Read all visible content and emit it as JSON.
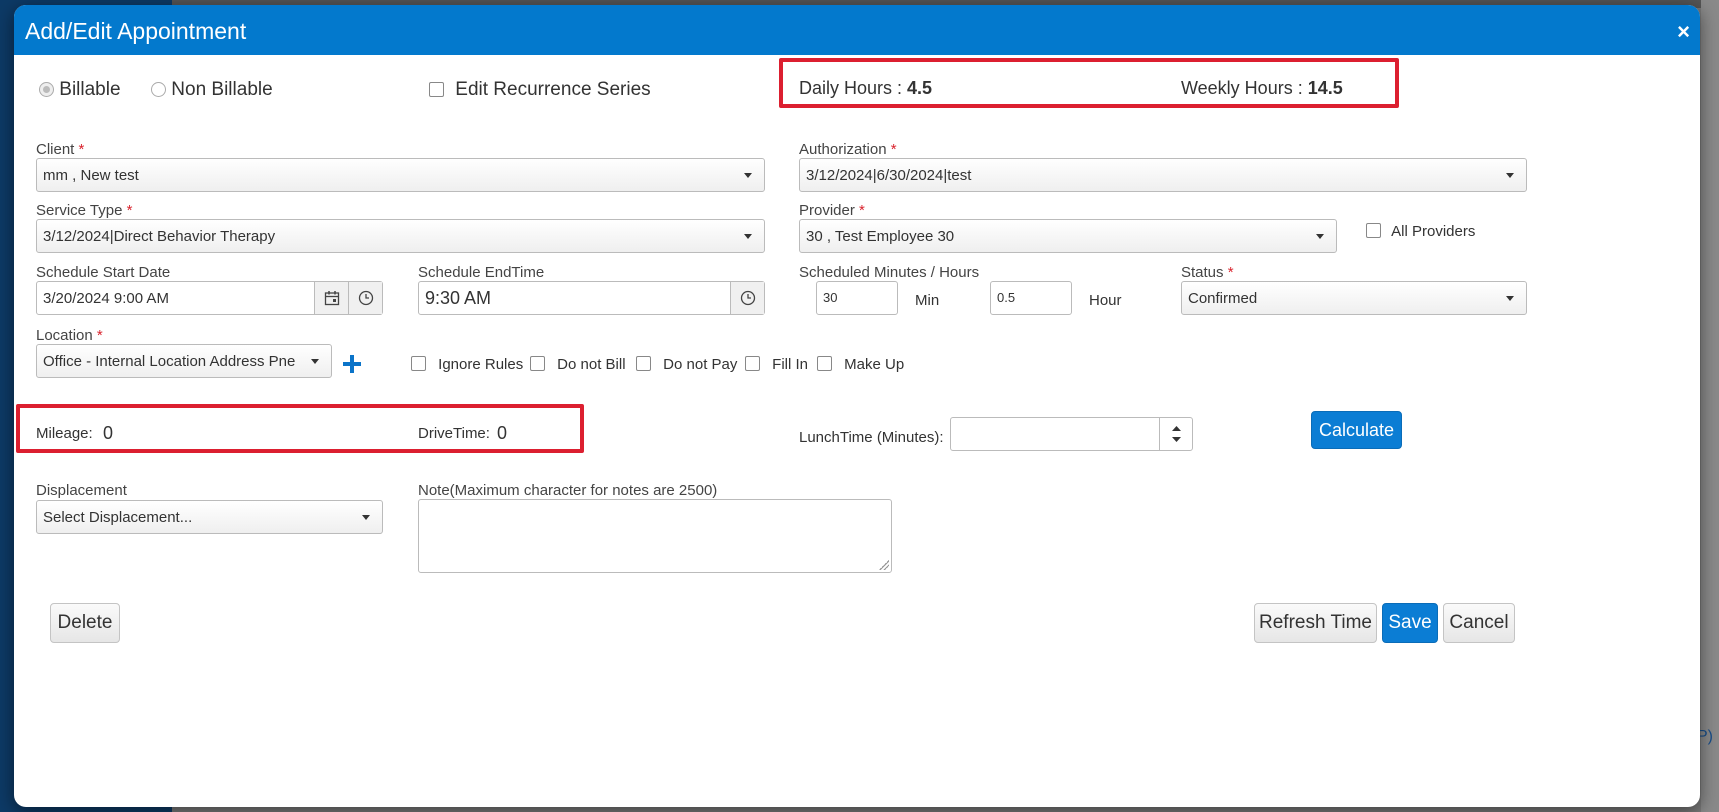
{
  "modal": {
    "title": "Add/Edit Appointment",
    "close_glyph": "×"
  },
  "billing": {
    "billable_label": "Billable",
    "non_billable_label": "Non Billable",
    "selected": "Billable",
    "edit_recurrence_label": "Edit Recurrence Series"
  },
  "hours": {
    "daily_label": "Daily Hours :",
    "daily_value": "4.5",
    "weekly_label": "Weekly Hours :",
    "weekly_value": "14.5"
  },
  "client": {
    "label": "Client",
    "value": "mm , New test"
  },
  "authorization": {
    "label": "Authorization",
    "value": "3/12/2024|6/30/2024|test"
  },
  "service_type": {
    "label": "Service Type",
    "value": "3/12/2024|Direct Behavior Therapy"
  },
  "provider": {
    "label": "Provider",
    "value": "30 , Test Employee 30",
    "all_providers_label": "All Providers"
  },
  "schedule": {
    "start_label": "Schedule Start Date",
    "start_value": "3/20/2024 9:00 AM",
    "end_label": "Schedule EndTime",
    "end_value": "9:30 AM",
    "minutes_hours_label": "Scheduled Minutes / Hours",
    "minutes_value": "30",
    "min_unit": "Min",
    "hours_value": "0.5",
    "hour_unit": "Hour"
  },
  "status": {
    "label": "Status",
    "value": "Confirmed"
  },
  "location": {
    "label": "Location",
    "value": "Office - Internal Location Address Pne"
  },
  "flags": {
    "ignore_rules": "Ignore Rules",
    "do_not_bill": "Do not Bill",
    "do_not_pay": "Do not Pay",
    "fill_in": "Fill In",
    "make_up": "Make Up"
  },
  "mileage": {
    "label": "Mileage:",
    "value": "0"
  },
  "drive_time": {
    "label": "DriveTime:",
    "value": "0"
  },
  "lunch": {
    "label": "LunchTime (Minutes):",
    "value": ""
  },
  "calculate_label": "Calculate",
  "displacement": {
    "label": "Displacement",
    "value": "Select Displacement..."
  },
  "note": {
    "label": "Note(Maximum character for notes are 2500)",
    "value": ""
  },
  "buttons": {
    "delete": "Delete",
    "refresh_time": "Refresh Time",
    "save": "Save",
    "cancel": "Cancel"
  },
  "required_marker": "*",
  "colors": {
    "header": "#0379cd",
    "primary_button": "#0b7dd4",
    "highlight_box": "#dc1f30",
    "required": "#d9232d"
  },
  "backdrop": {
    "bottom_link": "P)"
  }
}
